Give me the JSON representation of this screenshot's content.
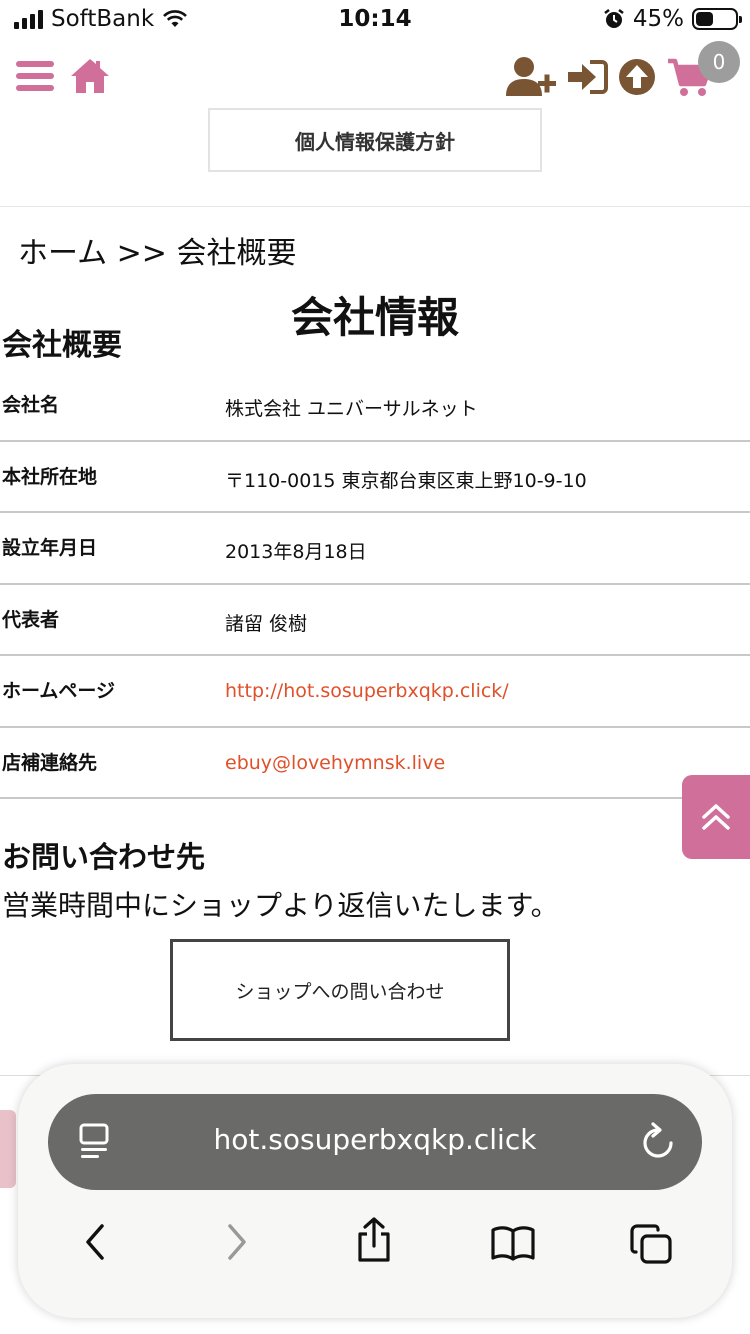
{
  "status_bar": {
    "carrier": "SoftBank",
    "time": "10:14",
    "battery": "45%",
    "battery_level": 0.45
  },
  "header": {
    "cart_count": "0"
  },
  "privacy_button": {
    "label": "個人情報保護方針"
  },
  "breadcrumb": "ホーム >> 会社概要",
  "page_title": "会社情報",
  "section_title": "会社概要",
  "company_info": [
    {
      "label": "会社名",
      "value": "株式会社 ユニバーサルネット",
      "link": false
    },
    {
      "label": "本社所在地",
      "value": "〒110-0015 東京都台東区東上野10-9-10",
      "link": false
    },
    {
      "label": "設立年月日",
      "value": "2013年8月18日",
      "link": false
    },
    {
      "label": "代表者",
      "value": "諸留 俊樹",
      "link": false
    },
    {
      "label": "ホームページ",
      "value": "http://hot.sosuperbxqkp.click/",
      "link": true
    },
    {
      "label": "店補連絡先",
      "value": "ebuy@lovehymnsk.live",
      "link": true
    }
  ],
  "contact": {
    "title": "お問い合わせ先",
    "description": "営業時間中にショップより返信いたします。",
    "button_label": "ショップへの問い合わせ"
  },
  "browser": {
    "url": "hot.sosuperbxqkp.click"
  },
  "colors": {
    "brand_pink": "#d0709a",
    "brand_brown": "#7a5533",
    "link": "#e0502a"
  }
}
